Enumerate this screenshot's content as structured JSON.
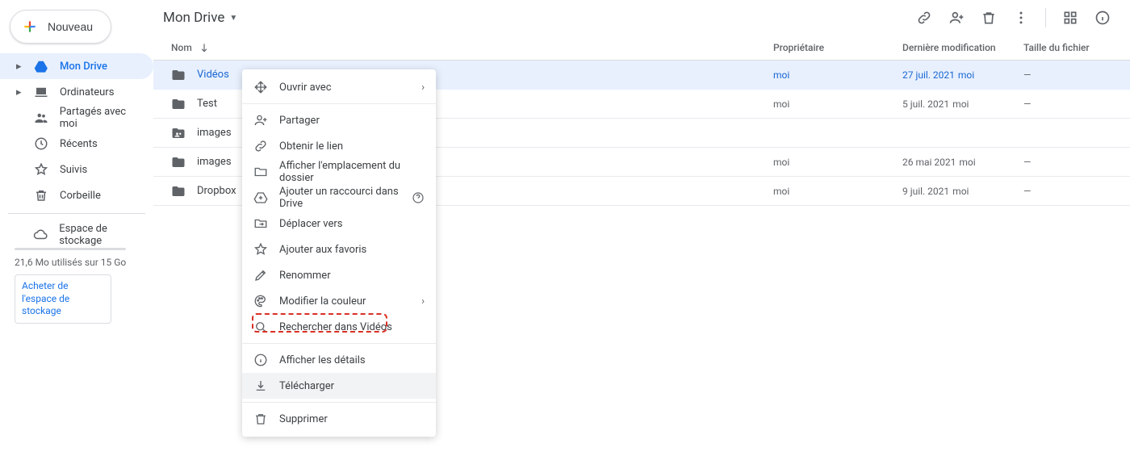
{
  "new_button": "Nouveau",
  "title": "Mon Drive",
  "nav": {
    "my_drive": "Mon Drive",
    "computers": "Ordinateurs",
    "shared": "Partagés avec moi",
    "recent": "Récents",
    "starred": "Suivis",
    "trash": "Corbeille",
    "storage": "Espace de stockage"
  },
  "storage": {
    "used": "21,6 Mo utilisés sur 15 Go",
    "buy": "Acheter de l'espace de stockage"
  },
  "columns": {
    "name": "Nom",
    "owner": "Propriétaire",
    "modified": "Dernière modification",
    "size": "Taille du fichier"
  },
  "rows": [
    {
      "name": "Vidéos",
      "owner": "moi",
      "modified": "27 juil. 2021",
      "by": "moi",
      "size": "—",
      "selected": true,
      "shared": false
    },
    {
      "name": "Test",
      "owner": "moi",
      "modified": "5 juil. 2021",
      "by": "moi",
      "size": "—",
      "selected": false,
      "shared": false
    },
    {
      "name": "images",
      "owner": "",
      "modified": "",
      "by": "",
      "size": "",
      "selected": false,
      "shared": true
    },
    {
      "name": "images",
      "owner": "moi",
      "modified": "26 mai 2021",
      "by": "moi",
      "size": "—",
      "selected": false,
      "shared": false
    },
    {
      "name": "Dropbox",
      "owner": "moi",
      "modified": "9 juil. 2021",
      "by": "moi",
      "size": "—",
      "selected": false,
      "shared": false
    }
  ],
  "context_menu": {
    "open_with": "Ouvrir avec",
    "share": "Partager",
    "get_link": "Obtenir le lien",
    "show_loc": "Afficher l'emplacement du dossier",
    "add_shortcut": "Ajouter un raccourci dans Drive",
    "move": "Déplacer vers",
    "star": "Ajouter aux favoris",
    "rename": "Renommer",
    "color": "Modifier la couleur",
    "search_in": "Rechercher dans Vidéos",
    "details": "Afficher les détails",
    "download": "Télécharger",
    "delete": "Supprimer"
  }
}
